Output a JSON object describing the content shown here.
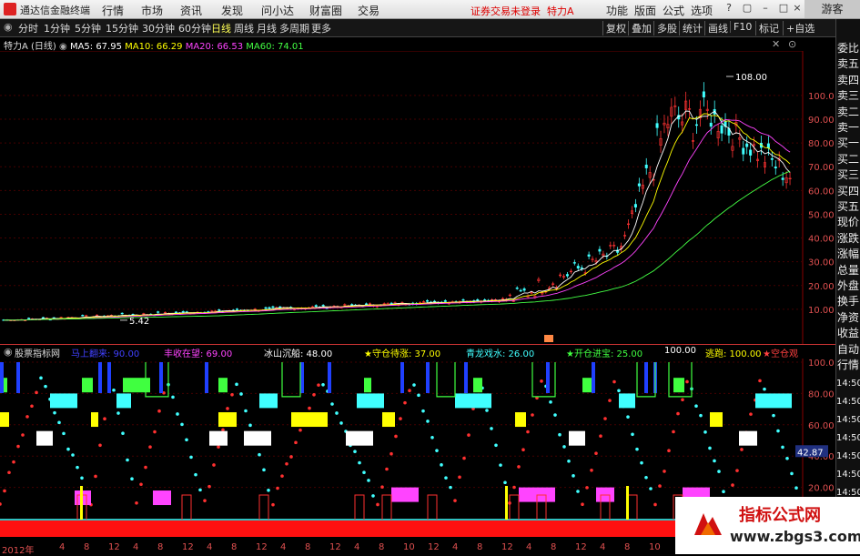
{
  "titlebar": {
    "app_title": "通达信金融终端",
    "menus": [
      "行情",
      "市场",
      "资讯",
      "发现",
      "问小达",
      "财富圈",
      "交易"
    ],
    "warning": "证券交易未登录",
    "stock_name": "特力A",
    "right_menus": [
      "功能",
      "版面",
      "公式",
      "选项"
    ],
    "guest": "游客"
  },
  "toolbar": {
    "periods": [
      "分时",
      "1分钟",
      "5分钟",
      "15分钟",
      "30分钟",
      "60分钟",
      "日线",
      "周线",
      "月线",
      "多周期",
      "更多"
    ],
    "active": "日线",
    "buttons": [
      "复权",
      "叠加",
      "多股",
      "统计",
      "画线",
      "F10",
      "标记",
      "+自选"
    ]
  },
  "main_chart": {
    "title": "特力A (日线)",
    "ma_values": [
      {
        "label": "MA5: 67.95",
        "color": "#ffffff"
      },
      {
        "label": "MA10: 66.29",
        "color": "#ffff00"
      },
      {
        "label": "MA20: 66.53",
        "color": "#ff44ff"
      },
      {
        "label": "MA60: 74.01",
        "color": "#44ff44"
      }
    ],
    "high_label": "108.00",
    "low_label": "5.42",
    "y_ticks": [
      "100.0",
      "90.00",
      "80.00",
      "70.00",
      "60.00",
      "50.00",
      "40.00",
      "30.00",
      "20.00",
      "10.00"
    ]
  },
  "indicator": {
    "name": "股票指标网",
    "items": [
      {
        "label": "马上翻来: 90.00",
        "color": "#4040ff"
      },
      {
        "label": "丰收在望: 69.00",
        "color": "#ff44ff"
      },
      {
        "label": "冰山沉船: 48.00",
        "color": "#ffffff"
      },
      {
        "label": "★守仓待涨: 37.00",
        "color": "#ffff00"
      },
      {
        "label": "青龙戏水: 26.00",
        "color": "#40ffff"
      },
      {
        "label": "★开仓进宝: 25.00",
        "color": "#40ff40"
      },
      {
        "label": "100.00",
        "color": "#ffffff"
      },
      {
        "label": "逃跑: 100.00",
        "color": "#ffff00"
      },
      {
        "label": "★空仓观",
        "color": "#ff4040"
      }
    ],
    "y_ticks": [
      "100.0",
      "80.00",
      "60.00",
      "40.00",
      "20.00"
    ],
    "current_value": "42.87"
  },
  "right_strip": [
    "委比",
    "卖五",
    "卖四",
    "卖三",
    "卖二",
    "卖一",
    "买一",
    "买二",
    "买三",
    "买四",
    "买五",
    "现价",
    "涨跌",
    "涨幅",
    "总量",
    "外盘",
    "换手",
    "净资",
    "收益",
    "自动",
    "行情"
  ],
  "right_strip_times": [
    "14:50",
    "14:50",
    "14:50",
    "14:50",
    "14:50",
    "14:50",
    "14:50"
  ],
  "x_labels": [
    "2012年",
    "4",
    "8",
    "12",
    "4",
    "8",
    "12",
    "4",
    "8",
    "12",
    "4",
    "8",
    "12",
    "4",
    "8",
    "10",
    "12",
    "4",
    "8",
    "12",
    "4",
    "8",
    "12",
    "4",
    "8",
    "10"
  ],
  "watermark": {
    "cn": "指标公式网",
    "url": "www.zbgs3.com"
  },
  "colors": {
    "up": "#ff3333",
    "down": "#40ffff",
    "grid": "#800000"
  }
}
